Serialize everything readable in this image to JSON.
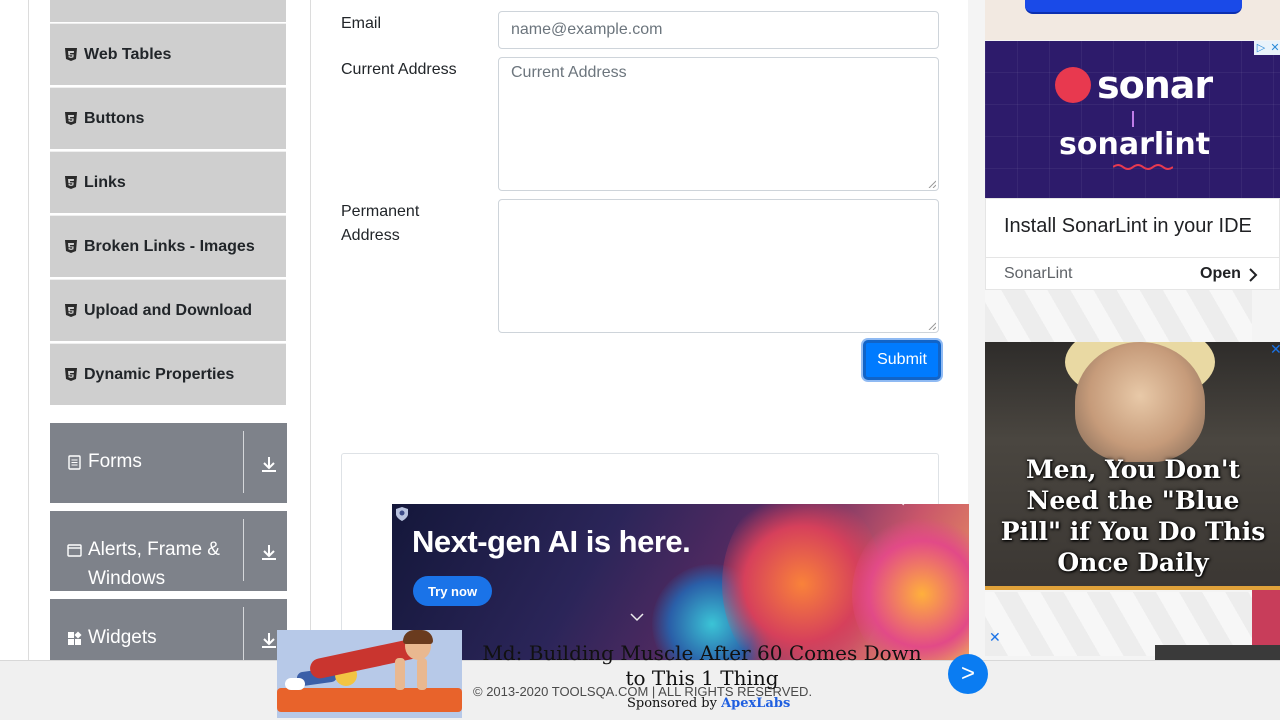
{
  "sidebar": {
    "items": [
      {
        "label": ""
      },
      {
        "label": "Web Tables"
      },
      {
        "label": "Buttons"
      },
      {
        "label": "Links"
      },
      {
        "label": "Broken Links - Images"
      },
      {
        "label": "Upload and Download"
      },
      {
        "label": "Dynamic Properties"
      }
    ],
    "groups": [
      {
        "label": "Forms",
        "icon": "form-icon"
      },
      {
        "label": "Alerts, Frame & Windows",
        "icon": "window-icon"
      },
      {
        "label": "Widgets",
        "icon": "widgets-icon"
      }
    ]
  },
  "form": {
    "email_label": "Email",
    "email_placeholder": "name@example.com",
    "current_address_label": "Current Address",
    "current_address_placeholder": "Current Address",
    "permanent_address_label": "Permanent Address",
    "permanent_address_value": "",
    "submit_label": "Submit"
  },
  "ads": {
    "sonar": {
      "logo_top": "sonar",
      "logo_bottom": "sonarlint",
      "headline": "Install SonarLint in your IDE",
      "brand": "SonarLint",
      "cta": "Open"
    },
    "men": {
      "text": "Men, You Don't Need the \"Blue Pill\" if You Do This Once Daily"
    },
    "ai": {
      "headline": "Next-gen AI is here.",
      "cta": "Try now"
    },
    "muscle": {
      "text": "Md: Building Muscle After 60 Comes Down to This 1 Thing",
      "sponsored_prefix": "Sponsored by",
      "sponsor": "ApexLabs",
      "next": ">"
    },
    "close": "✕"
  },
  "footer": {
    "copyright": "© 2013-2020 TOOLSQA.COM | ALL RIGHTS RESERVED."
  },
  "colors": {
    "primary": "#007bff",
    "sidebar_item_bg": "#cfcfcf",
    "group_bg": "#7e828a"
  }
}
